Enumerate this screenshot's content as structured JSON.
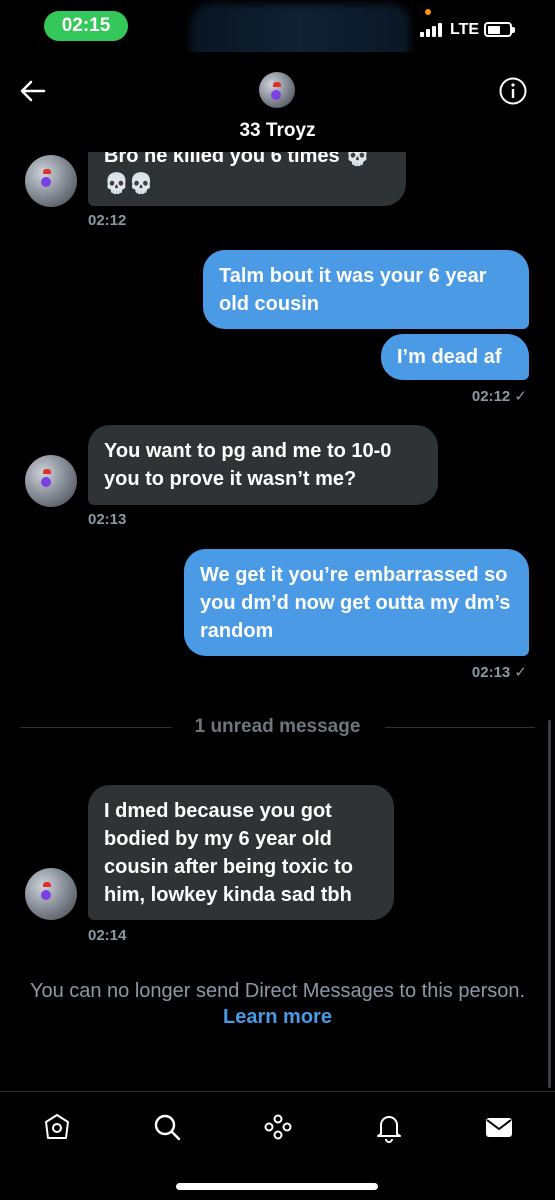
{
  "status_bar": {
    "time": "02:15",
    "network": "LTE"
  },
  "header": {
    "title": "33 Troyz"
  },
  "messages": [
    {
      "text": "Bro he killed you 6 times 💀 💀💀",
      "time": "02:12"
    },
    {
      "text": "Talm bout it was your 6 year old cousin"
    },
    {
      "text": "I’m dead af",
      "time": "02:12 ✓"
    },
    {
      "text": "You want to pg and me to 10-0 you to prove it wasn’t me?",
      "time": "02:13"
    },
    {
      "text": "We get it you’re embarrassed so you dm’d now get outta my dm’s random",
      "time": "02:13 ✓"
    },
    {
      "text": "I dmed because you got bodied by my 6 year old cousin after being toxic to him, lowkey kinda sad tbh",
      "time": "02:14"
    }
  ],
  "divider": {
    "label": "1 unread message"
  },
  "notice": {
    "text": "You can no longer send Direct Messages to this person.",
    "link": "Learn more"
  },
  "colors": {
    "outgoing_bubble": "#4a9ae6",
    "incoming_bubble": "#2f3336",
    "time_pill": "#34c759"
  },
  "tabs": [
    "home-icon",
    "search-icon",
    "spaces-icon",
    "notifications-icon",
    "messages-icon"
  ]
}
